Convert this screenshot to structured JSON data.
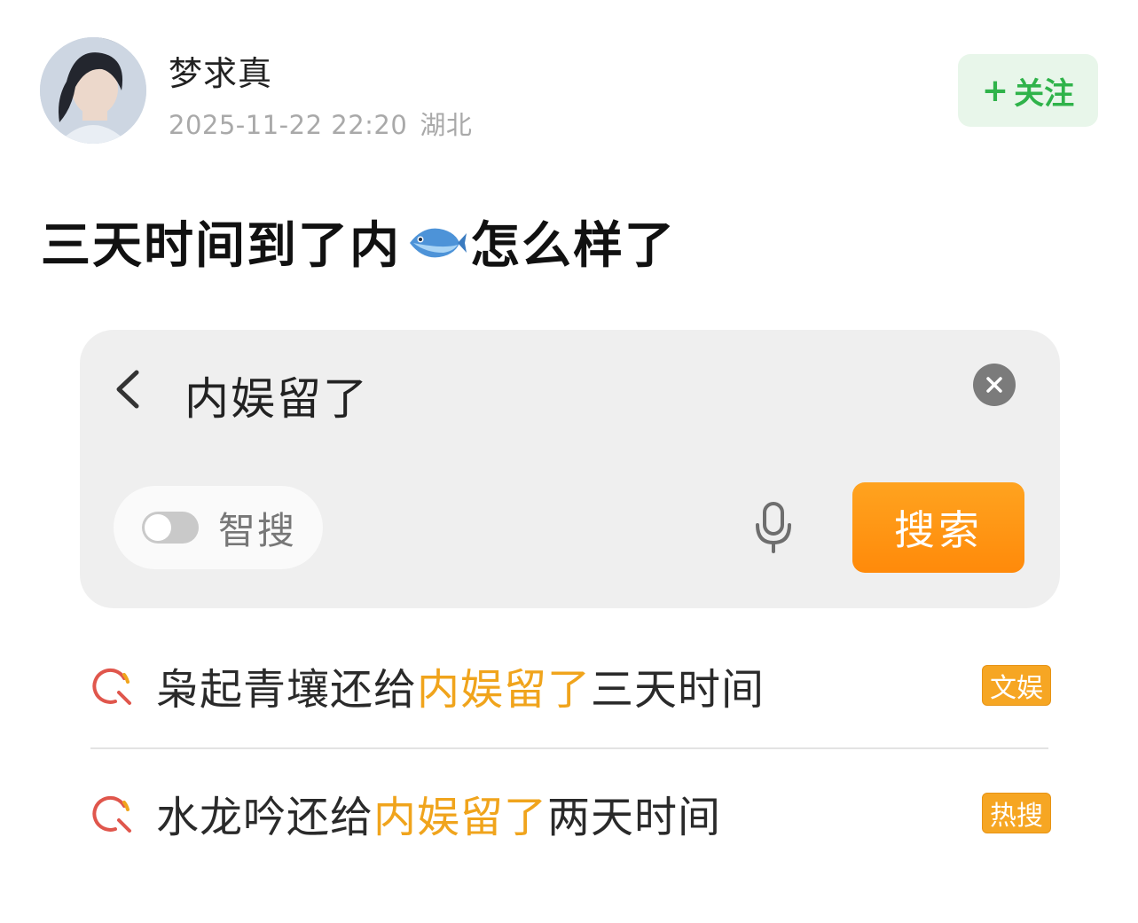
{
  "user": {
    "name": "梦求真",
    "timestamp": "2025-11-22 22:20",
    "location": "湖北"
  },
  "follow": {
    "plus": "+",
    "label": "关注"
  },
  "post": {
    "text_before": "三天时间到了内",
    "emoji": "fish-emoji",
    "text_after": "怎么样了"
  },
  "search": {
    "query": "内娱留了",
    "smart_label": "智搜",
    "smart_enabled": false,
    "button_label": "搜索"
  },
  "suggestions": [
    {
      "prefix": "枭起青壤还给",
      "highlight": "内娱留了",
      "suffix": "三天时间",
      "badge": "文娱"
    },
    {
      "prefix": "水龙吟还给",
      "highlight": "内娱留了",
      "suffix": "两天时间",
      "badge": "热搜"
    }
  ],
  "colors": {
    "follow_green": "#2fb34a",
    "search_orange": "#ff8a0a",
    "highlight": "#f0a41c",
    "badge": "#f6a623"
  }
}
